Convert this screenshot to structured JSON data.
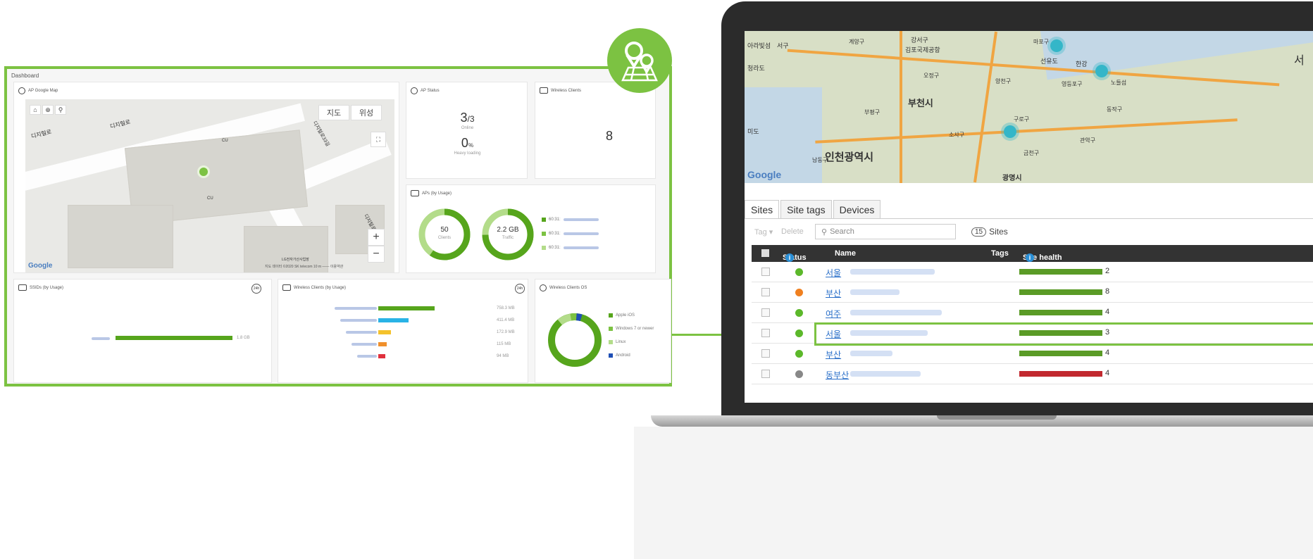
{
  "dashboard": {
    "title": "Dashboard",
    "map_card": {
      "title": "AP Google Map",
      "map_tab": "지도",
      "sat_tab": "위성",
      "google": "Google",
      "road1": "디지털로",
      "road2": "디지털로",
      "road3": "디지털로33길",
      "road4": "디지털로",
      "poi1": "CU",
      "poi2": "CU",
      "bldg_label": "LG전자가산사업장",
      "attribution": "지도 데이터 ©2020 SK telecom  10 m ——  이용약관"
    },
    "ap_status": {
      "title": "AP Status",
      "online_value": "3",
      "online_total": "/3",
      "online_label": "Online",
      "heavy_value": "0",
      "heavy_unit": "%",
      "heavy_label": "Heavy loading"
    },
    "wireless_clients": {
      "title": "Wireless Clients",
      "count": "8"
    },
    "aps_usage": {
      "title": "APs (by Usage)",
      "clients_value": "50",
      "clients_label": "Clients",
      "traffic_value": "2.2 GB",
      "traffic_label": "Traffic",
      "legend": [
        "60:31:",
        "60:31:",
        "60:31:"
      ]
    },
    "ssids": {
      "title": "SSIDs (by Usage)",
      "badge": "24h",
      "value": "1.8 GB"
    },
    "wc_usage": {
      "title": "Wireless Clients (by Usage)",
      "badge": "24h",
      "rows": [
        {
          "value": "758.3 MB",
          "pct": 1.0,
          "color": "#56a51c"
        },
        {
          "value": "411.4 MB",
          "pct": 0.54,
          "color": "#29b3e6"
        },
        {
          "value": "172.9 MB",
          "pct": 0.23,
          "color": "#f4c22c"
        },
        {
          "value": "115 MB",
          "pct": 0.15,
          "color": "#f0902c"
        },
        {
          "value": "94 MB",
          "pct": 0.12,
          "color": "#e0313d"
        }
      ]
    },
    "wc_os": {
      "title": "Wireless Clients OS",
      "legend": [
        {
          "label": "Apple iOS",
          "color": "#56a51c"
        },
        {
          "label": "Windows 7 or newer",
          "color": "#7cc242"
        },
        {
          "label": "Linux",
          "color": "#b3dc8a"
        },
        {
          "label": "Android",
          "color": "#1f4fb5"
        }
      ]
    }
  },
  "laptop": {
    "map": {
      "google": "Google",
      "city1": "인천광역시",
      "city2": "부천시",
      "city3": "광명시",
      "label1": "서",
      "label2": "강서구",
      "label3": "김포국제공항",
      "label4": "청라도",
      "label5": "계양구",
      "label6": "부평구",
      "label7": "소사구",
      "label8": "구로구",
      "label9": "금천구",
      "label10": "관악구",
      "label11": "동작구",
      "label12": "영등포구",
      "label13": "마포구",
      "label14": "한강",
      "label15": "오정구",
      "label16": "양천구",
      "label17": "노들섬",
      "label18": "선유도",
      "label19": "미도",
      "label20": "아라빛섬",
      "label21": "서구",
      "label22": "남동구"
    },
    "tabs": [
      "Sites",
      "Site tags",
      "Devices"
    ],
    "toolbar": {
      "tag": "Tag ▾",
      "delete": "Delete",
      "search_placeholder": "Search",
      "count": "15",
      "count_label": "Sites"
    },
    "table": {
      "headers": {
        "status": "Status",
        "name": "Name",
        "tags": "Tags",
        "health": "Site health"
      },
      "rows": [
        {
          "name": "서울",
          "status": "#5cb82a",
          "health_color": "#5a9b26",
          "val": "2"
        },
        {
          "name": "부산",
          "status": "#f08020",
          "health_color": "#5a9b26",
          "val": "8"
        },
        {
          "name": "여주",
          "status": "#5cb82a",
          "health_color": "#5a9b26",
          "val": "4"
        },
        {
          "name": "서울",
          "status": "#5cb82a",
          "health_color": "#5a9b26",
          "val": "3"
        },
        {
          "name": "부산",
          "status": "#5cb82a",
          "health_color": "#5a9b26",
          "val": "4"
        },
        {
          "name": "동부산",
          "status": "#888888",
          "health_color": "#c2292f",
          "val": "4"
        }
      ]
    }
  }
}
